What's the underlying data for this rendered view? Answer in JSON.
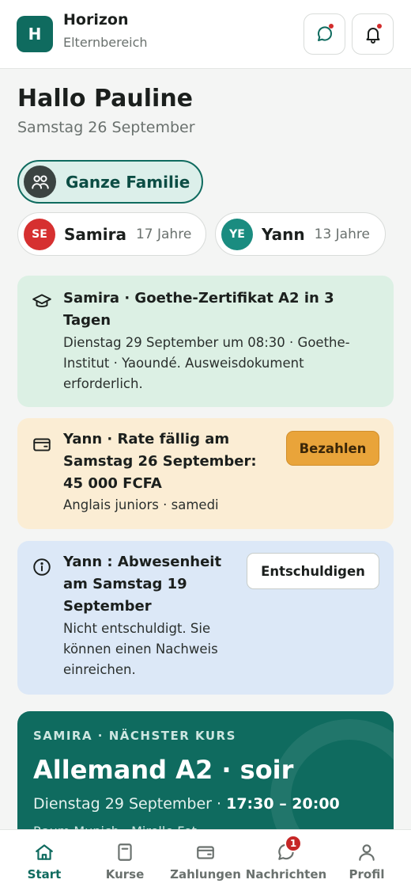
{
  "header": {
    "logo_letter": "H",
    "app_title": "Horizon",
    "app_subtitle": "Elternbereich"
  },
  "greeting": {
    "title": "Hallo Pauline",
    "date": "Samstag 26 September"
  },
  "filters": {
    "family_label": "Ganze Familie",
    "children": [
      {
        "initials": "SE",
        "name": "Samira",
        "age": "17 Jahre",
        "color": "#d63030"
      },
      {
        "initials": "YE",
        "name": "Yann",
        "age": "13 Jahre",
        "color": "#1a8c80"
      }
    ]
  },
  "cards": {
    "exam": {
      "title": "Samira · Goethe-Zertifikat A2 in 3 Tagen",
      "body": "Dienstag 29 September um 08:30 · Goethe-Institut · Yaoundé. Ausweisdokument erforderlich."
    },
    "payment": {
      "title": "Yann · Rate fällig am Samstag 26 September: 45 000 FCFA",
      "body": "Anglais juniors · samedi",
      "button": "Bezahlen"
    },
    "absence": {
      "title": "Yann : Abwesenheit am Samstag 19 September",
      "body": "Nicht entschuldigt. Sie können einen Nachweis einreichen.",
      "button": "Entschuldigen"
    }
  },
  "next_course": {
    "kicker": "SAMIRA · NÄCHSTER KURS",
    "title": "Allemand A2 · soir",
    "date": "Dienstag 29 September · ",
    "time": "17:30 – 20:00",
    "extra": "Raum Munich · Mirelle Fot"
  },
  "nav": {
    "items": [
      {
        "label": "Start",
        "icon": "home-icon"
      },
      {
        "label": "Kurse",
        "icon": "book-icon"
      },
      {
        "label": "Zahlungen",
        "icon": "wallet-icon"
      },
      {
        "label": "Nachrichten",
        "icon": "chat-icon",
        "badge": "1"
      },
      {
        "label": "Profil",
        "icon": "user-icon"
      }
    ]
  },
  "colors": {
    "brand": "#0f6b5f",
    "exam_card": "#dcf0e4",
    "payment_card": "#fbedd4",
    "absence_card": "#dce8f7",
    "pay_button": "#e9a43a"
  }
}
